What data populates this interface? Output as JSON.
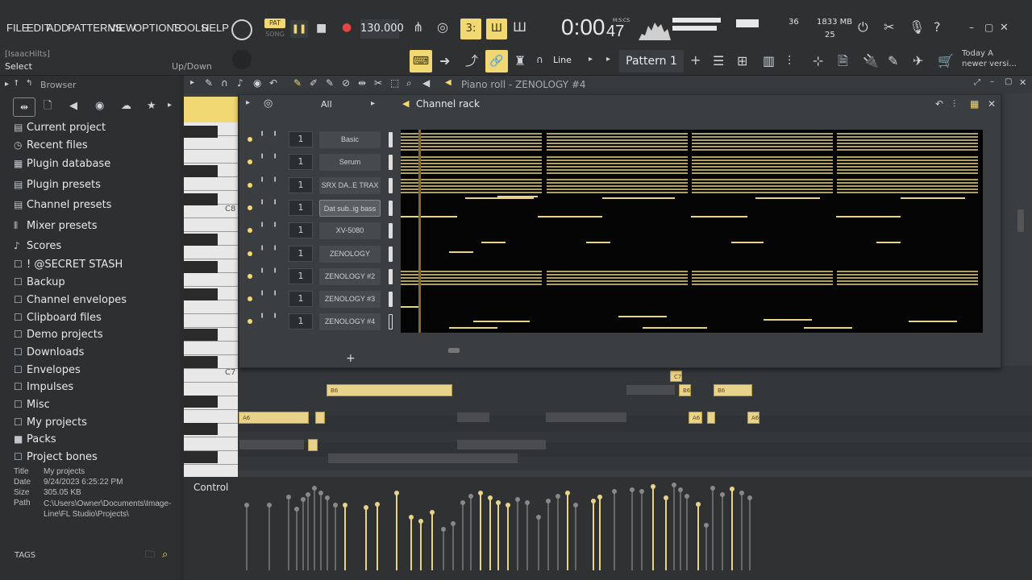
{
  "menu": [
    "FILE",
    "EDIT",
    "ADD",
    "PATTERNS",
    "VIEW",
    "OPTIONS",
    "TOOLS",
    "HELP"
  ],
  "transport": {
    "pat": "PAT",
    "song": "SONG",
    "tempo": "130.000",
    "time": "0:00",
    "time_small": "47",
    "time_unit": "M:S:CS",
    "cpu": "36",
    "mem": "1833 MB",
    "poly": "25"
  },
  "hint": {
    "user": "[IsaacHilts]",
    "action": "Select",
    "mode": "Up/Down"
  },
  "snap": "Line",
  "pattern": "Pattern 1",
  "news": {
    "line1": "Today  A",
    "line2": "newer versi..."
  },
  "browser": {
    "title": "Browser",
    "items": [
      "Current project",
      "Recent files",
      "Plugin database",
      "Plugin presets",
      "Channel presets",
      "Mixer presets",
      "Scores",
      "! @SECRET STASH",
      "Backup",
      "Channel envelopes",
      "Clipboard files",
      "Demo projects",
      "Downloads",
      "Envelopes",
      "Impulses",
      "Misc",
      "My projects",
      "Packs",
      "Project bones"
    ],
    "icons": [
      "▤",
      "◷",
      "▦",
      "▤",
      "▤",
      "⫴",
      "♪",
      "☐",
      "☐",
      "☐",
      "☐",
      "☐",
      "☐",
      "☐",
      "☐",
      "☐",
      "☐",
      "■",
      "☐"
    ],
    "meta": {
      "title_label": "Title",
      "title": "My projects",
      "date_label": "Date",
      "date": "9/24/2023 6:25:22 PM",
      "size_label": "Size",
      "size": "305.05 KB",
      "path_label": "Path",
      "path": "C:\\Users\\Owner\\Documents\\Image-Line\\FL Studio\\Projects\\"
    },
    "tags": "TAGS"
  },
  "pianoroll": {
    "title": "Piano roll - ZENOLOGY #4",
    "c8": "C8",
    "c7": "C7",
    "control": "Control"
  },
  "rack": {
    "title": "Channel rack",
    "filter": "All",
    "channels": [
      {
        "num": "1",
        "name": "Basic"
      },
      {
        "num": "1",
        "name": "Serum"
      },
      {
        "num": "1",
        "name": "SRX DA..E TRAX"
      },
      {
        "num": "1",
        "name": "Dat sub..ig bass"
      },
      {
        "num": "1",
        "name": "XV-5080"
      },
      {
        "num": "1",
        "name": "ZENOLOGY"
      },
      {
        "num": "1",
        "name": "ZENOLOGY #2"
      },
      {
        "num": "1",
        "name": "ZENOLOGY #3"
      },
      {
        "num": "1",
        "name": "ZENOLOGY #4"
      }
    ],
    "add": "+"
  },
  "notes": {
    "c7": "C7",
    "b6": "B6",
    "a6": "A6"
  }
}
